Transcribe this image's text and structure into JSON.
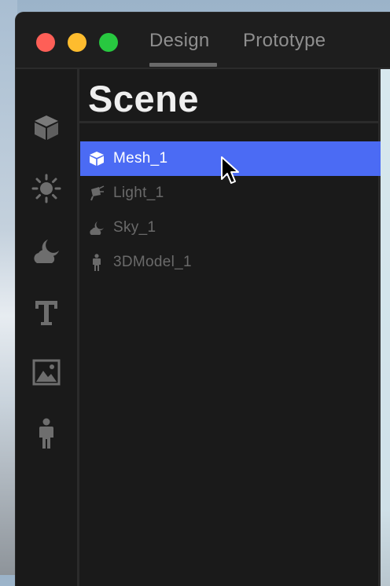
{
  "window": {
    "tabs": [
      {
        "label": "Design",
        "active": true
      },
      {
        "label": "Prototype",
        "active": false
      }
    ]
  },
  "sidebar": {
    "icons": [
      "cube-icon",
      "sun-icon",
      "cloud-moon-icon",
      "text-icon",
      "image-icon",
      "person-icon"
    ]
  },
  "panel": {
    "title": "Scene",
    "items": [
      {
        "label": "Mesh_1",
        "icon": "cube-icon",
        "selected": true
      },
      {
        "label": "Light_1",
        "icon": "spotlight-icon",
        "selected": false
      },
      {
        "label": "Sky_1",
        "icon": "cloud-moon-icon",
        "selected": false
      },
      {
        "label": "3DModel_1",
        "icon": "person-icon",
        "selected": false
      }
    ]
  },
  "colors": {
    "accent": "#4b6bf4",
    "close": "#fe5f57",
    "minimize": "#febc2e",
    "maximize": "#28c840"
  }
}
